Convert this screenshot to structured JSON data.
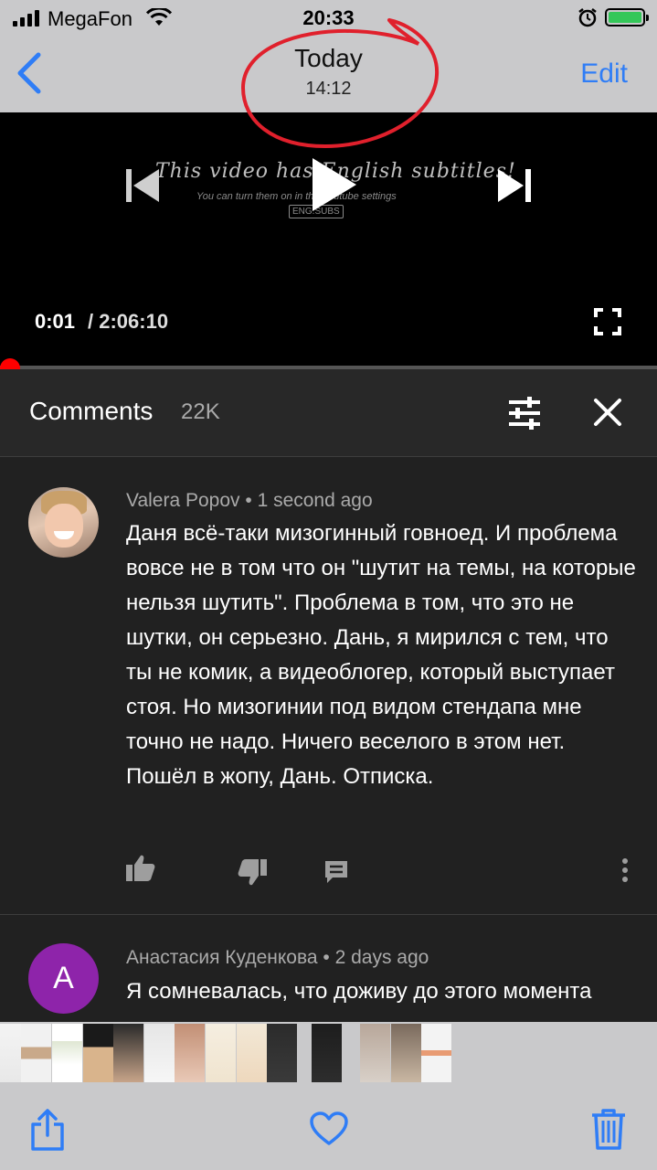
{
  "status_bar": {
    "carrier": "MegaFon",
    "time": "20:33"
  },
  "nav": {
    "title": "Today",
    "subtitle": "14:12",
    "edit_label": "Edit"
  },
  "video": {
    "overlay_title": "This video has English subtitles!",
    "overlay_hint": "You can turn them on in the Youtube settings",
    "overlay_tag": "ENG.SUBS",
    "current_time": "0:01",
    "duration": "/ 2:06:10",
    "progress_fraction": 0.0001
  },
  "comments": {
    "title": "Comments",
    "count": "22K",
    "items": [
      {
        "author": "Valera Popov",
        "age": "1 second ago",
        "text": "Даня всё-таки мизогинный говноед. И проблема вовсе не в том что он \"шутит на темы, на которые нельзя шутить\". Проблема в том, что это не шутки, он серьезно. Дань, я мирился с тем, что ты не комик, а видеоблогер, который выступает стоя. Но мизогинии под видом стендапа мне точно не надо. Ничего веселого в этом нет. Пошёл в жопу, Дань. Отписка."
      },
      {
        "author": "Анастасия Куденкова",
        "age": "2 days ago",
        "avatar_letter": "A",
        "avatar_color": "#8e24aa",
        "text": "Я сомневалась, что доживу до этого момента"
      }
    ]
  },
  "colors": {
    "accent_blue": "#2f7df6",
    "progress_red": "#ff0000",
    "annotation_red": "#e0202c"
  }
}
